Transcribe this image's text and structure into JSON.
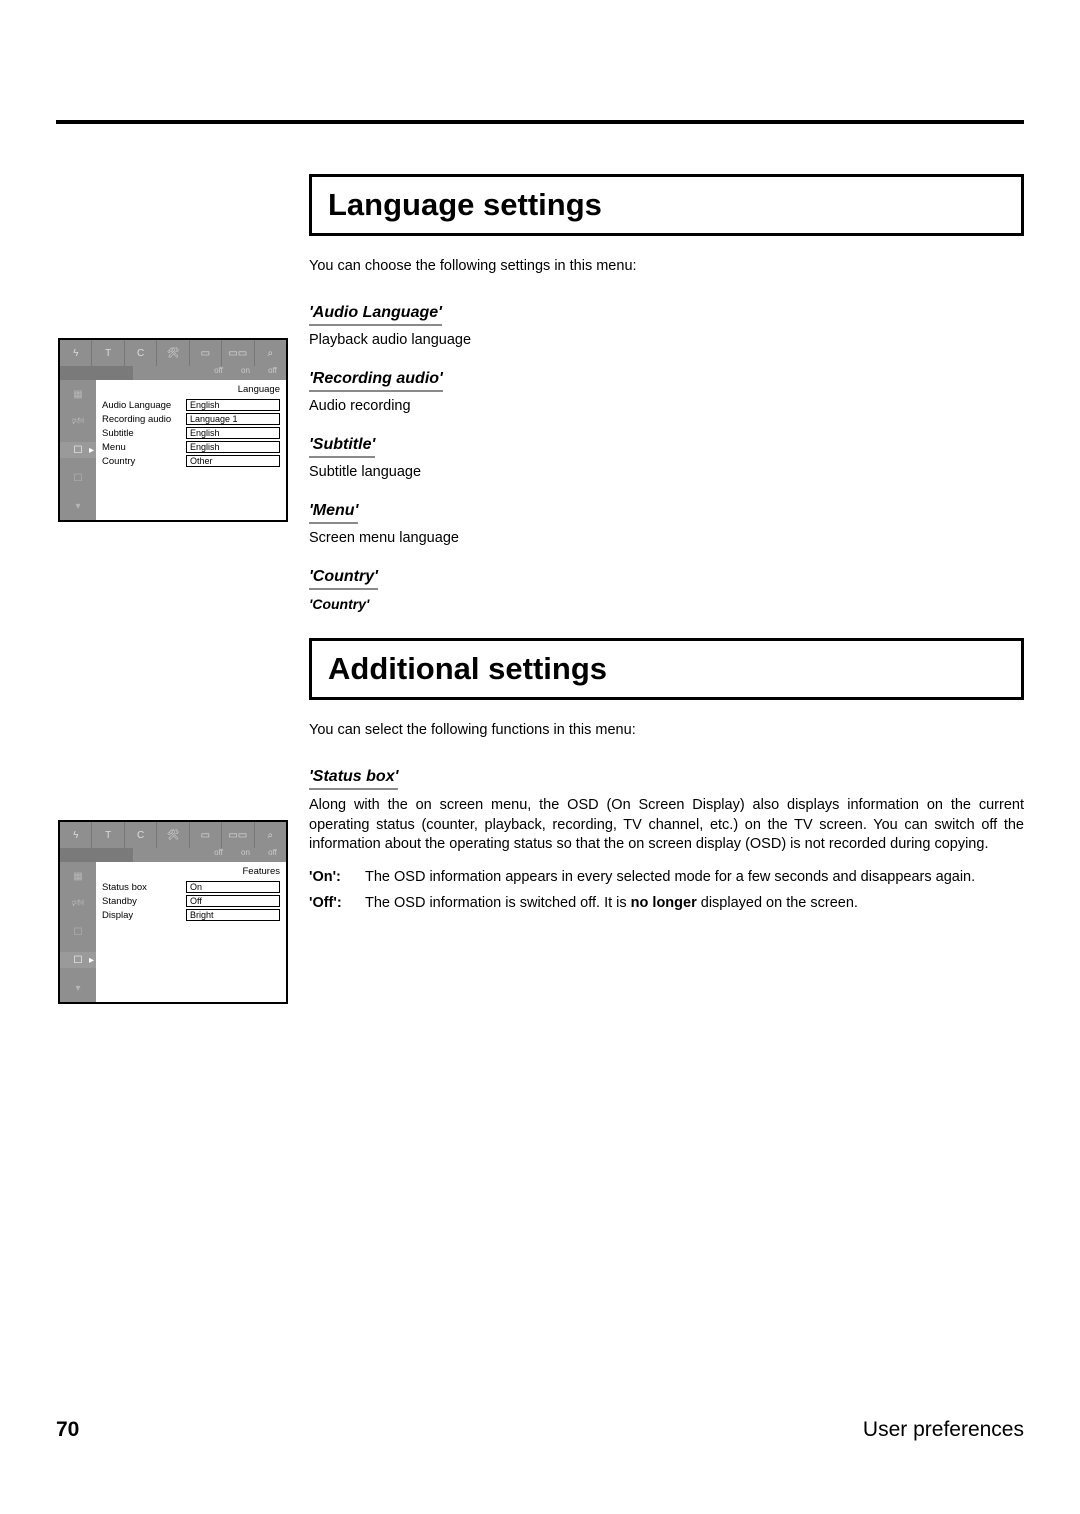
{
  "footer": {
    "page_number": "70",
    "title": "User preferences"
  },
  "section1": {
    "title": "Language settings",
    "intro": "You can choose the following settings in this menu:",
    "items": [
      {
        "heading": "'Audio Language'",
        "text": "Playback audio language"
      },
      {
        "heading": "'Recording audio'",
        "text": "Audio recording"
      },
      {
        "heading": "'Subtitle'",
        "text": "Subtitle language"
      },
      {
        "heading": "'Menu'",
        "text": "Screen menu language"
      },
      {
        "heading": "'Country'",
        "text": "'Country'"
      }
    ]
  },
  "section2": {
    "title": "Additional settings",
    "intro": "You can select the following functions in this menu:",
    "status_heading": "'Status box'",
    "status_para": "Along with the on screen menu, the OSD (On Screen Display) also displays information on the current operating status (counter, playback, recording, TV channel, etc.) on the TV screen. You can switch off the information about the operating status so that the on screen display (OSD) is not recorded during copying.",
    "defs": {
      "on_k": "'On':",
      "on_v": "The OSD information appears in every selected mode for a few seconds and disappears again.",
      "off_k": "'Off':",
      "off_v_pre": "The OSD information is switched off. It is ",
      "off_v_bold": "no longer",
      "off_v_post": " displayed on the screen."
    }
  },
  "osd1": {
    "title": "Language",
    "sub_labels": [
      "off",
      "on",
      "off"
    ],
    "rows": [
      {
        "k": "Audio Language",
        "v": "English"
      },
      {
        "k": "Recording audio",
        "v": "Language 1"
      },
      {
        "k": "Subtitle",
        "v": "English"
      },
      {
        "k": "Menu",
        "v": "English"
      },
      {
        "k": "Country",
        "v": "Other"
      }
    ],
    "top_icons": [
      "antenna",
      "T",
      "C",
      "wrench",
      "tv",
      "cassette",
      "search"
    ]
  },
  "osd2": {
    "title": "Features",
    "sub_labels": [
      "off",
      "on",
      "off"
    ],
    "rows": [
      {
        "k": "Status box",
        "v": "On"
      },
      {
        "k": "Standby",
        "v": "Off"
      },
      {
        "k": "Display",
        "v": "Bright"
      }
    ],
    "top_icons": [
      "antenna",
      "T",
      "C",
      "wrench",
      "tv",
      "cassette",
      "search"
    ]
  }
}
